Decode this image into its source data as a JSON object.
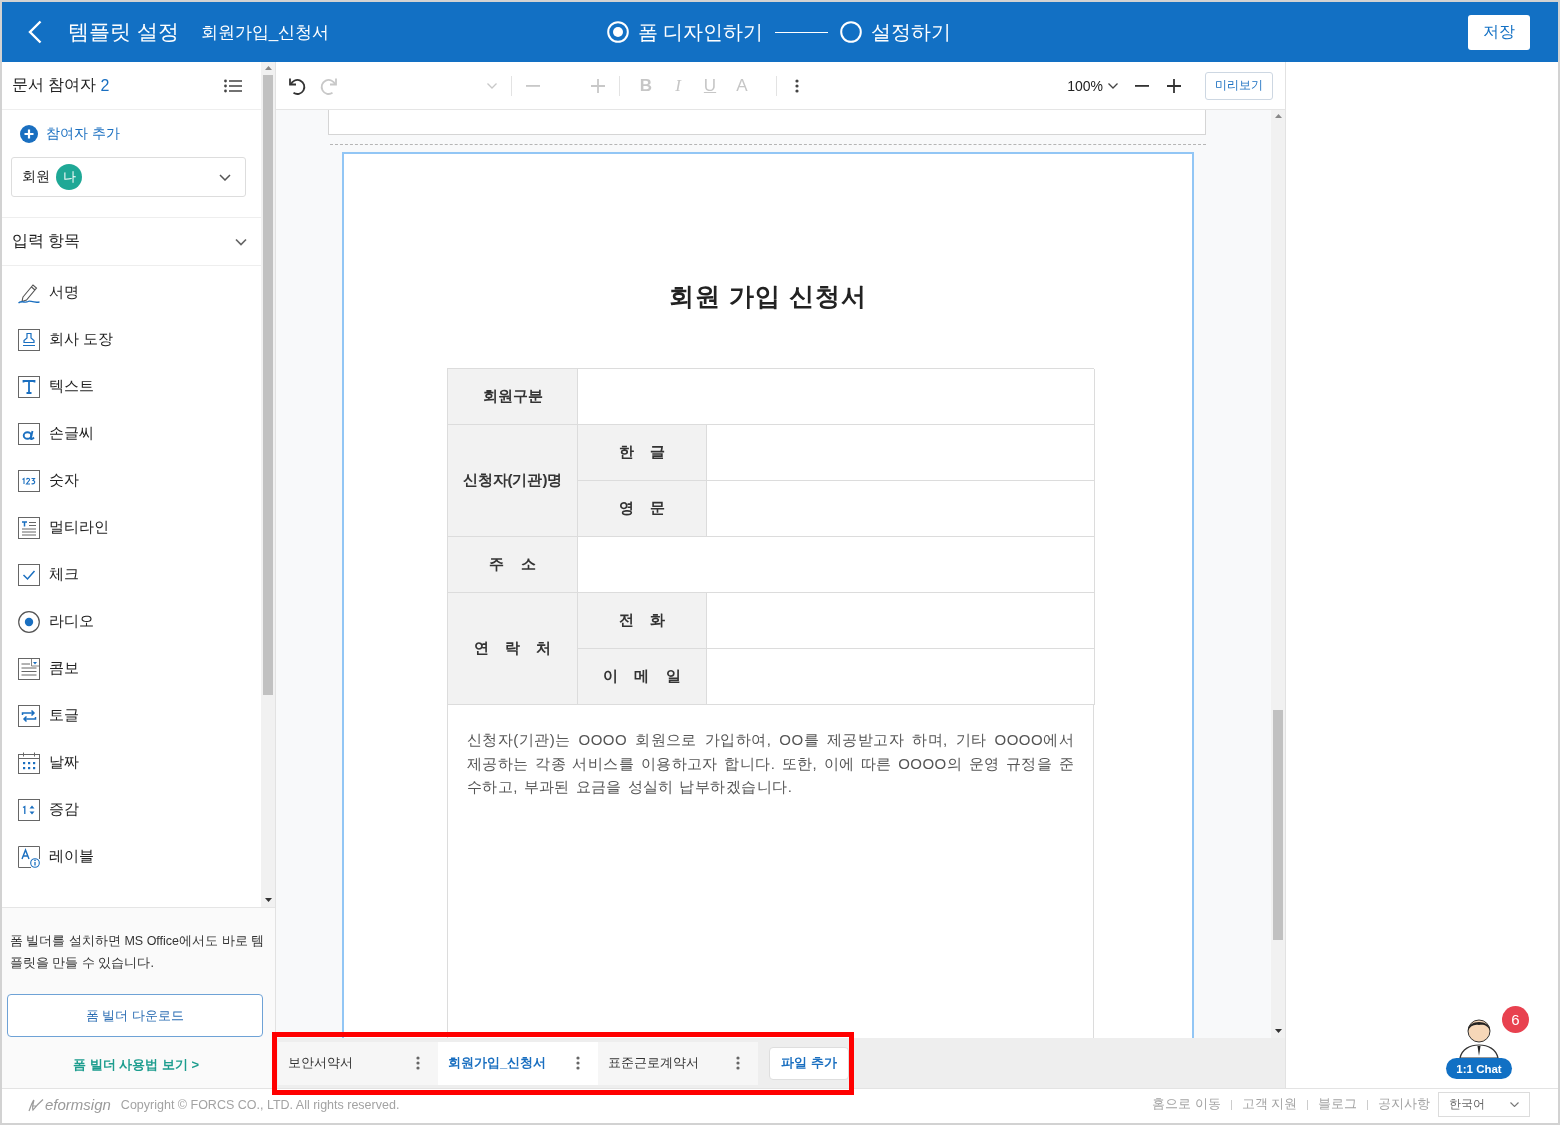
{
  "header": {
    "title": "템플릿 설정",
    "document_name": "회원가입_신청서",
    "steps": [
      {
        "label": "폼 디자인하기",
        "selected": true
      },
      {
        "label": "설정하기",
        "selected": false
      }
    ],
    "save_button": "저장"
  },
  "sidebar": {
    "title": "문서 참여자",
    "participant_count": "2",
    "add_participant": "참여자 추가",
    "participant": {
      "role": "회원",
      "avatar": "나",
      "color": "#1fa896"
    },
    "fields_section": {
      "title": "입력 항목",
      "expanded": true
    },
    "fields": [
      {
        "kind": "signature",
        "label": "서명"
      },
      {
        "kind": "stamp",
        "label": "회사 도장"
      },
      {
        "kind": "text",
        "label": "텍스트"
      },
      {
        "kind": "handwriting",
        "label": "손글씨"
      },
      {
        "kind": "number",
        "label": "숫자"
      },
      {
        "kind": "multiline",
        "label": "멀티라인"
      },
      {
        "kind": "check",
        "label": "체크"
      },
      {
        "kind": "radio",
        "label": "라디오"
      },
      {
        "kind": "combo",
        "label": "콤보"
      },
      {
        "kind": "toggle",
        "label": "토글"
      },
      {
        "kind": "date",
        "label": "날짜"
      },
      {
        "kind": "stepper",
        "label": "증감"
      },
      {
        "kind": "label",
        "label": "레이블"
      }
    ],
    "promo_text": "폼 빌더를 설치하면 MS Office에서도 바로 템플릿을 만들 수 있습니다.",
    "download_button": "폼 빌더 다운로드",
    "guide_link": "폼 빌더 사용법 보기 >"
  },
  "toolbar": {
    "history": [
      {
        "kind": "undo",
        "disabled": false
      },
      {
        "kind": "redo",
        "disabled": true
      }
    ],
    "font_controls_disabled": true,
    "format_buttons": [
      {
        "kind": "bold",
        "label": "B",
        "disabled": true
      },
      {
        "kind": "italic",
        "label": "I",
        "disabled": true
      },
      {
        "kind": "underline",
        "label": "U",
        "disabled": true
      },
      {
        "kind": "color",
        "label": "A",
        "disabled": true
      }
    ],
    "zoom": "100%",
    "preview_button": "미리보기"
  },
  "document": {
    "selected": true,
    "title": "회원 가입 신청서",
    "table": {
      "sections": [
        {
          "label": "회원구분"
        },
        {
          "label": "신청자(기관)명",
          "sublabels": [
            "한 글",
            "영 문"
          ]
        },
        {
          "label": "주 소"
        },
        {
          "label": "연 락 처",
          "sublabels": [
            "전 화",
            "이 메 일"
          ]
        }
      ],
      "notice": "신청자(기관)는 OOOO 회원으로 가입하여, OO를 제공받고자 하며, 기타 OOOO에서 제공하는 각종 서비스를 이용하고자 합니다. 또한, 이에 따른 OOOO의 운영 규정을 준수하고, 부과된 요금을 성실히 납부하겠습니다."
    }
  },
  "file_tabs": {
    "highlighted": true,
    "tabs": [
      {
        "label": "보안서약서",
        "selected": false
      },
      {
        "label": "회원가입_신청서",
        "selected": true
      },
      {
        "label": "표준근로계약서",
        "selected": false
      }
    ],
    "add_button": "파일 추가"
  },
  "chat": {
    "label": "1:1 Chat",
    "badge": "6"
  },
  "footer": {
    "logo": "eformsign",
    "copyright": "Copyright © FORCS CO., LTD. All rights reserved.",
    "links": [
      "홈으로 이동",
      "고객 지원",
      "블로그",
      "공지사항"
    ],
    "language": "한국어"
  }
}
